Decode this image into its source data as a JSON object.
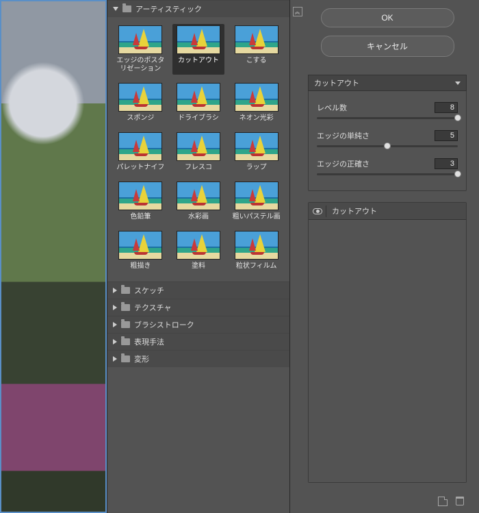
{
  "buttons": {
    "ok": "OK",
    "cancel": "キャンセル"
  },
  "categories": {
    "artistic": "アーティスティック",
    "sketch": "スケッチ",
    "texture": "テクスチャ",
    "brushstrokes": "ブラシストローク",
    "stylize": "表現手法",
    "distort": "変形"
  },
  "filters": {
    "artistic": [
      {
        "label": "エッジのポスタリゼーション"
      },
      {
        "label": "カットアウト",
        "selected": true
      },
      {
        "label": "こする"
      },
      {
        "label": "スポンジ"
      },
      {
        "label": "ドライブラシ"
      },
      {
        "label": "ネオン光彩"
      },
      {
        "label": "パレットナイフ"
      },
      {
        "label": "フレスコ"
      },
      {
        "label": "ラップ"
      },
      {
        "label": "色鉛筆"
      },
      {
        "label": "水彩画"
      },
      {
        "label": "粗いパステル画"
      },
      {
        "label": "粗描き"
      },
      {
        "label": "塗料"
      },
      {
        "label": "粒状フィルム"
      }
    ]
  },
  "selected_effect": "カットアウト",
  "params": {
    "levels": {
      "label": "レベル数",
      "value": "8",
      "pct": 100
    },
    "simplicity": {
      "label": "エッジの単純さ",
      "value": "5",
      "pct": 50
    },
    "fidelity": {
      "label": "エッジの正確さ",
      "value": "3",
      "pct": 100
    }
  },
  "layer": {
    "name": "カットアウト"
  }
}
